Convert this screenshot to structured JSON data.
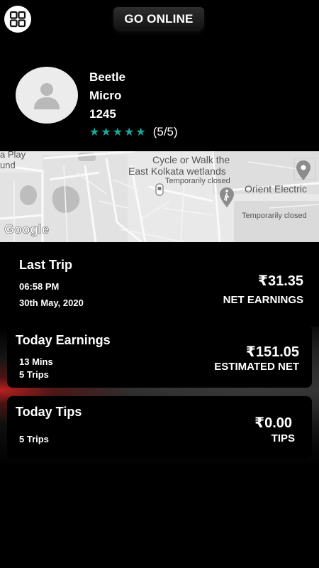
{
  "header": {
    "menu_icon": "grid-icon",
    "go_online_label": "GO ONLINE"
  },
  "profile": {
    "avatar_icon": "person-icon",
    "name": "Beetle",
    "vehicle_type": "Micro",
    "vehicle_number": "1245",
    "rating_stars": "★★★★★",
    "rating_value": 5,
    "rating_text": "(5/5)"
  },
  "map": {
    "labels": {
      "play_ground_top": "a Play",
      "play_ground_bottom": "und",
      "wetlands_line1": "Cycle or Walk the",
      "wetlands_line2": "East Kolkata wetlands",
      "temporarily_closed_1": "Temporarily closed",
      "orient_electric": "Orient Electric",
      "temporarily_closed_2": "Temporarily closed"
    },
    "google_logo": "Google"
  },
  "last_trip": {
    "title": "Last Trip",
    "time": "06:58 PM",
    "date": "30th May, 2020",
    "amount": "₹31.35",
    "caption": "NET EARNINGS"
  },
  "today_earnings": {
    "title": "Today Earnings",
    "duration": "13 Mins",
    "trips": "5 Trips",
    "amount": "₹151.05",
    "caption": "ESTIMATED NET"
  },
  "today_tips": {
    "title": "Today Tips",
    "trips": "5 Trips",
    "amount": "₹0.00",
    "caption": "TIPS"
  },
  "colors": {
    "star": "#1aa89a",
    "background": "#000000",
    "map_bg": "#e9e9e9"
  }
}
